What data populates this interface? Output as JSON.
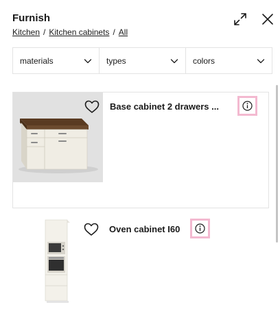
{
  "header": {
    "title": "Furnish",
    "breadcrumb": [
      "Kitchen",
      "Kitchen cabinets",
      "All"
    ],
    "breadcrumb_separator": "/",
    "icons": {
      "expand": "expand-arrows-icon",
      "close": "close-icon"
    }
  },
  "filters": [
    {
      "label": "materials",
      "icon": "chevron-down-icon"
    },
    {
      "label": "types",
      "icon": "chevron-down-icon"
    },
    {
      "label": "colors",
      "icon": "chevron-down-icon"
    }
  ],
  "products": [
    {
      "name": "Base cabinet 2 drawers ...",
      "favorite_icon": "heart-outline-icon",
      "info_icon": "info-circle-icon"
    },
    {
      "name": "Oven cabinet I60",
      "favorite_icon": "heart-outline-icon",
      "info_icon": "info-circle-icon"
    }
  ],
  "colors": {
    "text": "#1a1a1a",
    "border": "#e3e3e3",
    "info_highlight": "#f3b9d0",
    "thumb_background": "#e1e1e1",
    "countertop": "#6b4a2e",
    "cabinet_body": "#f0ede4"
  }
}
